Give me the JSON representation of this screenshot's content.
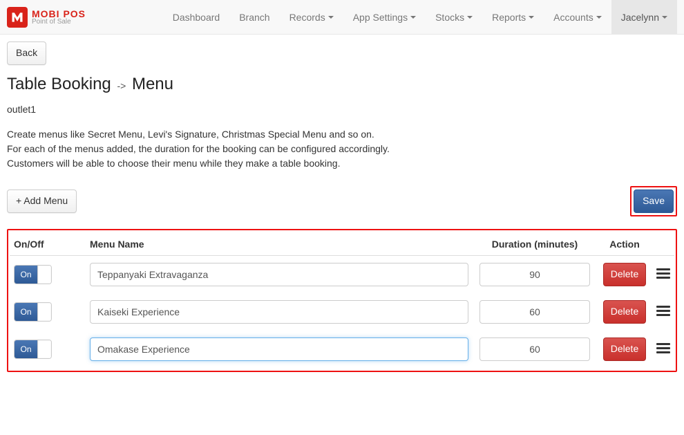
{
  "brand": {
    "name": "MOBI POS",
    "tagline": "Point of Sale"
  },
  "nav": {
    "items": [
      {
        "label": "Dashboard",
        "dropdown": false
      },
      {
        "label": "Branch",
        "dropdown": false
      },
      {
        "label": "Records",
        "dropdown": true
      },
      {
        "label": "App Settings",
        "dropdown": true
      },
      {
        "label": "Stocks",
        "dropdown": true
      },
      {
        "label": "Reports",
        "dropdown": true
      },
      {
        "label": "Accounts",
        "dropdown": true
      }
    ],
    "user": {
      "label": "Jacelynn",
      "dropdown": true
    }
  },
  "back_label": "Back",
  "title": {
    "root": "Table Booking",
    "separator": "->",
    "leaf": "Menu"
  },
  "outlet": "outlet1",
  "description": [
    "Create menus like Secret Menu, Levi's Signature, Christmas Special Menu and so on.",
    "For each of the menus added, the duration for the booking can be configured accordingly.",
    "Customers will be able to choose their menu while they make a table booking."
  ],
  "buttons": {
    "add_menu": "+ Add Menu",
    "save": "Save",
    "delete": "Delete",
    "toggle_on": "On"
  },
  "table": {
    "headers": {
      "onoff": "On/Off",
      "name": "Menu Name",
      "duration": "Duration (minutes)",
      "action": "Action"
    },
    "rows": [
      {
        "on": true,
        "name": "Teppanyaki Extravaganza",
        "duration": "90",
        "focused": false
      },
      {
        "on": true,
        "name": "Kaiseki Experience",
        "duration": "60",
        "focused": false
      },
      {
        "on": true,
        "name": "Omakase Experience",
        "duration": "60",
        "focused": true
      }
    ]
  }
}
